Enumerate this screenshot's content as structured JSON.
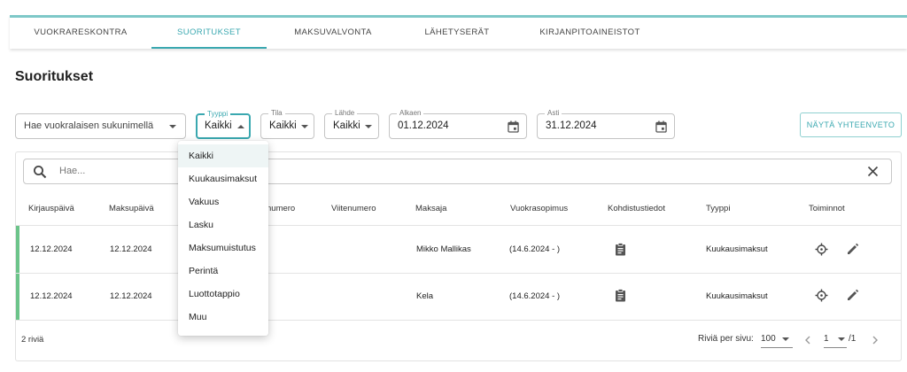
{
  "nav": {
    "tabs": [
      {
        "label": "VUOKRARESKONTRA"
      },
      {
        "label": "SUORITUKSET"
      },
      {
        "label": "MAKSUVALVONTA"
      },
      {
        "label": "LÄHETYSERÄT"
      },
      {
        "label": "KIRJANPITOAINEISTOT"
      }
    ],
    "active_tab": "SUORITUKSET"
  },
  "page_title": "Suoritukset",
  "filters": {
    "tenant_placeholder": "Hae vuokralaisen sukunimellä",
    "type": {
      "label": "Tyyppi",
      "value": "Kaikki"
    },
    "status": {
      "label": "Tila",
      "value": "Kaikki"
    },
    "source": {
      "label": "Lähde",
      "value": "Kaikki"
    },
    "start": {
      "label": "Alkaen",
      "value": "01.12.2024"
    },
    "end": {
      "label": "Asti",
      "value": "31.12.2024"
    },
    "summary_button": "NÄYTÄ YHTEENVETO"
  },
  "search": {
    "placeholder": "Hae..."
  },
  "table": {
    "headers": {
      "entry_date": "Kirjauspäivä",
      "payment_date": "Maksupäivä",
      "number": "numero",
      "reference": "Viitenumero",
      "payer": "Maksaja",
      "lease": "Vuokrasopimus",
      "allocation": "Kohdistustiedot",
      "type": "Tyyppi",
      "actions": "Toiminnot"
    },
    "rows": [
      {
        "entry_date": "12.12.2024",
        "payment_date": "12.12.2024",
        "payer": "Mikko Mallikas",
        "lease": "(14.6.2024 - )",
        "type": "Kuukausimaksut"
      },
      {
        "entry_date": "12.12.2024",
        "payment_date": "12.12.2024",
        "payer": "Kela",
        "lease": "(14.6.2024 - )",
        "type": "Kuukausimaksut"
      }
    ]
  },
  "footer": {
    "row_count": "2 riviä",
    "rows_per_page_label": "Riviä per sivu:",
    "rows_per_page": "100",
    "page": "1",
    "page_total": "/1"
  },
  "type_dropdown": {
    "options": [
      {
        "label": "Kaikki"
      },
      {
        "label": "Kuukausimaksut"
      },
      {
        "label": "Vakuus"
      },
      {
        "label": "Lasku"
      },
      {
        "label": "Maksumuistutus"
      },
      {
        "label": "Perintä"
      },
      {
        "label": "Luottotappio"
      },
      {
        "label": "Muu"
      }
    ],
    "selected": "Kaikki"
  },
  "colors": {
    "accent": "#3aa8b0",
    "row_status": "#6cc48a",
    "nav_border": "#7ec8c8"
  }
}
